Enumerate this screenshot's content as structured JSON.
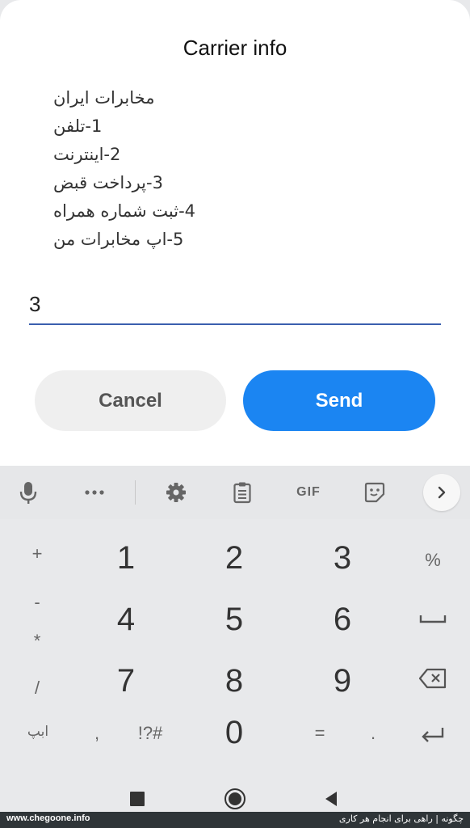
{
  "dialog": {
    "title": "Carrier info",
    "message_lines": [
      "مخابرات ایران",
      "1-تلفن",
      "2-اینترنت",
      "3-پرداخت قبض",
      "4-ثبت شماره همراه",
      "5-اپ مخابرات من"
    ],
    "input_value": "3",
    "cancel_label": "Cancel",
    "send_label": "Send"
  },
  "toolbar": {
    "icons": [
      "microphone-icon",
      "more-icon",
      "settings-icon",
      "clipboard-icon",
      "gif-icon",
      "sticker-icon",
      "chevron-right-icon"
    ],
    "gif_label": "GIF"
  },
  "keyboard": {
    "keys": {
      "plus": "+",
      "minus": "-",
      "asterisk": "*",
      "slash": "/",
      "k1": "1",
      "k2": "2",
      "k3": "3",
      "k4": "4",
      "k5": "5",
      "k6": "6",
      "k7": "7",
      "k8": "8",
      "k9": "9",
      "k0": "0",
      "percent": "%",
      "lang": "ابپ",
      "comma": ",",
      "symbols": "!?#",
      "equals": "=",
      "period": "."
    }
  },
  "navbar": {
    "icons": [
      "recents-square-icon",
      "home-circle-icon",
      "back-triangle-icon"
    ]
  },
  "footer": {
    "site": "www.chegoone.info",
    "tagline": "چگونه | راهی برای انجام هر کاری"
  },
  "colors": {
    "accent": "#1b85f2",
    "underline": "#3b5fae"
  }
}
